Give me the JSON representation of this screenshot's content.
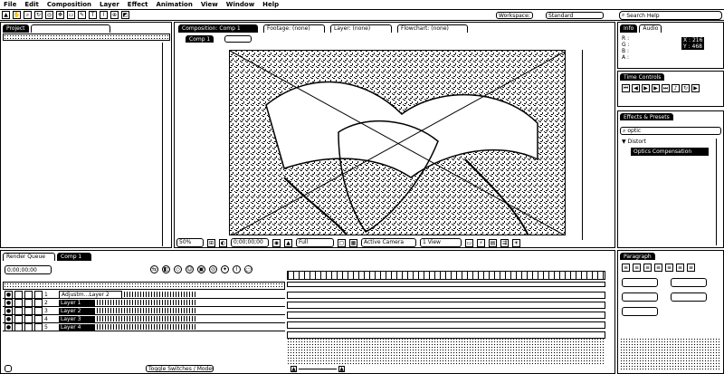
{
  "menu": [
    "File",
    "Edit",
    "Composition",
    "Layer",
    "Effect",
    "Animation",
    "View",
    "Window",
    "Help"
  ],
  "toolbar": {
    "workspace_label": "Workspace:",
    "workspace_value": "Standard"
  },
  "search_help": {
    "placeholder": "Search Help"
  },
  "composition_tabs": [
    "Composition: Comp 1",
    "Footage: (none)",
    "Layer: (none)",
    "Flowchart: (none)"
  ],
  "comp_subtab": "Comp 1",
  "viewer_footer": {
    "zoom": "50%",
    "timecode": "0;00;00;00",
    "resolution": "Full",
    "view": "Active Camera",
    "views": "1 View"
  },
  "info_panel": {
    "tabs": [
      "Info",
      "Audio"
    ],
    "r": "R :",
    "g": "G :",
    "b": "B :",
    "a": "A :",
    "x": "X : 216",
    "y": "Y : 468"
  },
  "preview_panel": {
    "title": "Time Controls"
  },
  "effects_panel": {
    "tab": "Effects & Presets",
    "search_value": "optic",
    "category": "Distort",
    "effect": "Optics Compensation"
  },
  "project_panel": {
    "tab": "Project"
  },
  "timeline": {
    "tabs": [
      "Render Queue",
      "Comp 1"
    ],
    "timecode": "0;00;00;00",
    "layers": [
      {
        "num": "1",
        "name": "Adjustm...Layer 2",
        "selected": true
      },
      {
        "num": "2",
        "name": "Layer 1",
        "selected": false
      },
      {
        "num": "3",
        "name": "Layer 2",
        "selected": false
      },
      {
        "num": "4",
        "name": "Layer 3",
        "selected": false
      },
      {
        "num": "5",
        "name": "Layer 4",
        "selected": false
      }
    ],
    "footer_toggle": "Toggle Switches / Modes"
  },
  "paragraph_panel": {
    "tab": "Paragraph"
  },
  "colors": {
    "fg": "#000000",
    "bg": "#ffffff"
  }
}
